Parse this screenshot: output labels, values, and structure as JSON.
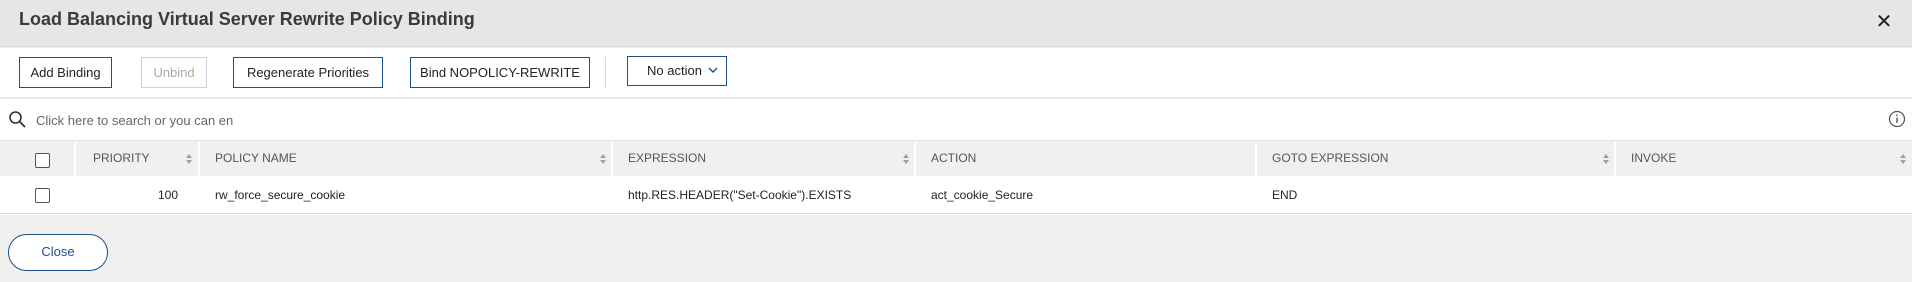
{
  "dialog": {
    "title": "Load Balancing Virtual Server Rewrite Policy Binding",
    "close_icon": "close-icon"
  },
  "toolbar": {
    "add_binding": "Add Binding",
    "unbind": "Unbind",
    "regenerate": "Regenerate Priorities",
    "bind_nopolicy": "Bind NOPOLICY-REWRITE",
    "action_select": "No action"
  },
  "search": {
    "placeholder": "Click here to search or you can en",
    "icon": "search-icon",
    "info_icon": "info-icon"
  },
  "table": {
    "columns": [
      "PRIORITY",
      "POLICY NAME",
      "EXPRESSION",
      "ACTION",
      "GOTO EXPRESSION",
      "INVOKE"
    ],
    "rows": [
      {
        "priority": "100",
        "policy_name": "rw_force_secure_cookie",
        "expression": "http.RES.HEADER(\"Set-Cookie\").EXISTS",
        "action": "act_cookie_Secure",
        "goto_expression": "END",
        "invoke": ""
      }
    ]
  },
  "footer": {
    "close": "Close"
  },
  "colors": {
    "accent": "#1f4f87",
    "header_bg": "#e6e6e6",
    "table_header_bg": "#eef0f2"
  }
}
